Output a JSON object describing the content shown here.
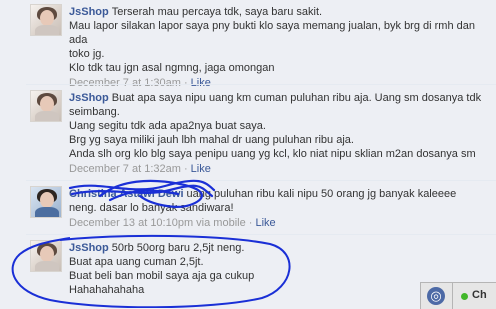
{
  "comments": [
    {
      "author": "JsShop",
      "lines": [
        "Terserah mau percaya tdk, saya baru sakit.",
        "Mau lapor silakan lapor saya pny bukti klo saya memang jualan, byk brg di rmh dan ada",
        "toko jg.",
        "Klo tdk tau jgn asal ngmng, jaga omongan"
      ],
      "timestamp": "December 7 at 1:30am",
      "like": "Like"
    },
    {
      "author": "JsShop",
      "lines": [
        "Buat apa saya nipu uang km cuman puluhan ribu aja. Uang sm dosanya tdk",
        "seimbang.",
        "Uang segitu tdk ada apa2nya buat saya.",
        "Brg yg saya miliki jauh lbh mahal dr uang puluhan ribu aja.",
        "Anda slh org klo blg saya penipu uang yg kcl, klo niat nipu sklian m2an dosanya sm"
      ],
      "timestamp": "December 7 at 1:32am",
      "like": "Like"
    },
    {
      "author": "Christina Astawi Dewi",
      "lines": [
        "uang puluhan ribu kali nipu 50 orang jg banyak kaleeee",
        "neng. dasar lo banyak sandiwara!"
      ],
      "timestamp": "December 13 at 10:10pm via mobile",
      "like": "Like"
    },
    {
      "author": "JsShop",
      "lines": [
        "50rb 50org baru 2,5jt neng.",
        "Buat apa uang cuman 2,5jt.",
        "Buat beli ban mobil saya aja ga cukup",
        "Hahahahahaha"
      ]
    }
  ],
  "separator": " · ",
  "chat": {
    "label": "Ch",
    "icon": "globe-icon"
  }
}
